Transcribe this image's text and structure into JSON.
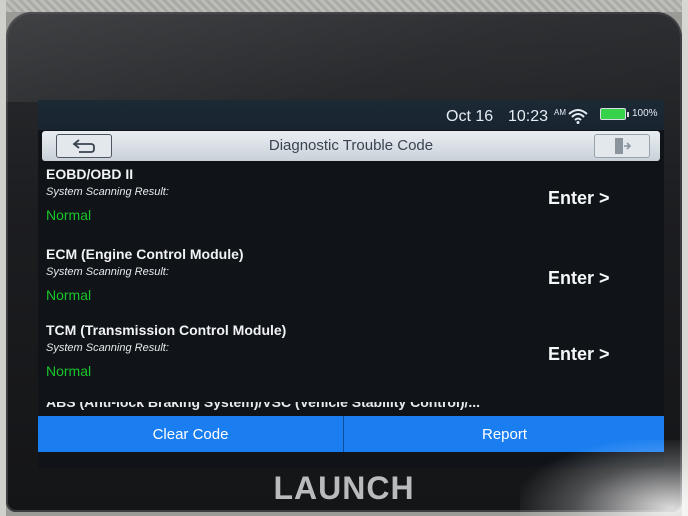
{
  "status_bar": {
    "date": "Oct 16",
    "time": "10:23",
    "ampm": "AM",
    "wifi_icon": "wifi-icon",
    "battery_icon": "battery-icon",
    "battery_percent": "100%"
  },
  "title_bar": {
    "title": "Diagnostic Trouble Code",
    "back_icon": "back-arrow-icon",
    "exit_icon": "exit-icon"
  },
  "systems": [
    {
      "name": "EOBD/OBD II",
      "scan_label": "System Scanning Result:",
      "status": "Normal",
      "action": "Enter >"
    },
    {
      "name": "ECM (Engine Control Module)",
      "scan_label": "System Scanning Result:",
      "status": "Normal",
      "action": "Enter >"
    },
    {
      "name": "TCM (Transmission Control Module)",
      "scan_label": "System Scanning Result:",
      "status": "Normal",
      "action": "Enter >"
    }
  ],
  "partial_entry": "ABS (Anti-lock Braking System)/VSC (Vehicle Stability Control)/...",
  "bottom_bar": {
    "clear_code": "Clear Code",
    "report": "Report"
  },
  "brand": "LAUNCH",
  "colors": {
    "status_normal": "#19c52a",
    "action_bar": "#1a7ef0",
    "screen_bg": "#101418"
  }
}
